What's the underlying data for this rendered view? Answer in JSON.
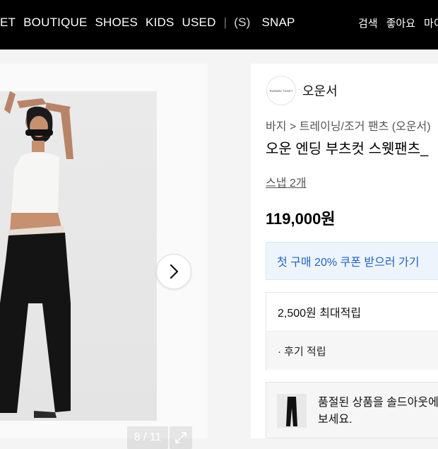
{
  "header": {
    "nav_items": [
      "ET",
      "BOUTIQUE",
      "SHOES",
      "KIDS",
      "USED"
    ],
    "snap_logo": "(S)",
    "snap_label": "SNAP",
    "right_items": [
      "검색",
      "좋아요",
      "마이"
    ]
  },
  "gallery": {
    "counter": "8 / 11"
  },
  "product": {
    "brand_logo_text": "RUNWAY TICKET",
    "brand": "오운서",
    "breadcrumb": "바지 > 트레이닝/조거 팬츠 (오운서)",
    "title": "오운 엔딩 부츠컷 스웻팬츠_",
    "snap_link": "스냅 2개",
    "price": "119,000원",
    "coupon": "첫 구매 20% 쿠폰 받으러 가기",
    "points_max": "2,500원 최대적립",
    "points_review": "· 후기 적립",
    "soldout_line1": "품절된 상품을 솔드아웃에",
    "soldout_line2": "보세요."
  },
  "colors": {
    "header_bg": "#000000",
    "accent_blue": "#1f63c8",
    "coupon_bg": "#eef4fb"
  }
}
